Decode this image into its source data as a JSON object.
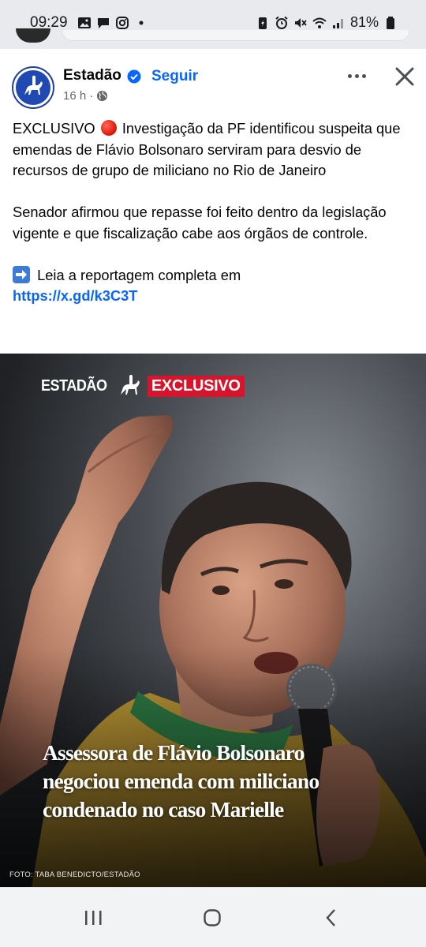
{
  "status_bar": {
    "time": "09:29",
    "left_icons": [
      "gallery-icon",
      "chat-bubble-icon",
      "instagram-icon",
      "dot-icon"
    ],
    "right_icons": [
      "battery-saver-icon",
      "alarm-icon",
      "mute-icon",
      "wifi-icon",
      "signal-icon",
      "battery-icon"
    ],
    "battery": "81%"
  },
  "post": {
    "page_name": "Estadão",
    "follow_label": "Seguir",
    "timestamp": "16 h",
    "separator": "·",
    "audience_icon": "globe-icon",
    "text_line1_prefix": "EXCLUSIVO",
    "text_line1_rest": "Investigação da PF identificou suspeita que emendas de Flávio Bolsonaro serviram para desvio de recursos de grupo de miliciano no Rio de Janeiro",
    "text_para2": "Senador afirmou que repasse foi feito dentro da legislação vigente e que fiscalização cabe aos órgãos de controle.",
    "text_para3": "Leia a reportagem completa em",
    "link": "https://x.gd/k3C3T"
  },
  "image": {
    "brand": "ESTADÃO",
    "badge": "EXCLUSIVO",
    "headline_lines": [
      "Assessora de Flávio Bolsonaro",
      "negociou emenda com miliciano",
      "condenado no caso Marielle"
    ],
    "credit": "FOTO: TABA BENEDICTO/ESTADÃO"
  },
  "nav": {
    "buttons": [
      "recent-apps-icon",
      "home-icon",
      "back-icon"
    ]
  },
  "colors": {
    "accent": "#0866ff",
    "badge_red": "#d7142b",
    "status_bg": "#e9eaee"
  }
}
